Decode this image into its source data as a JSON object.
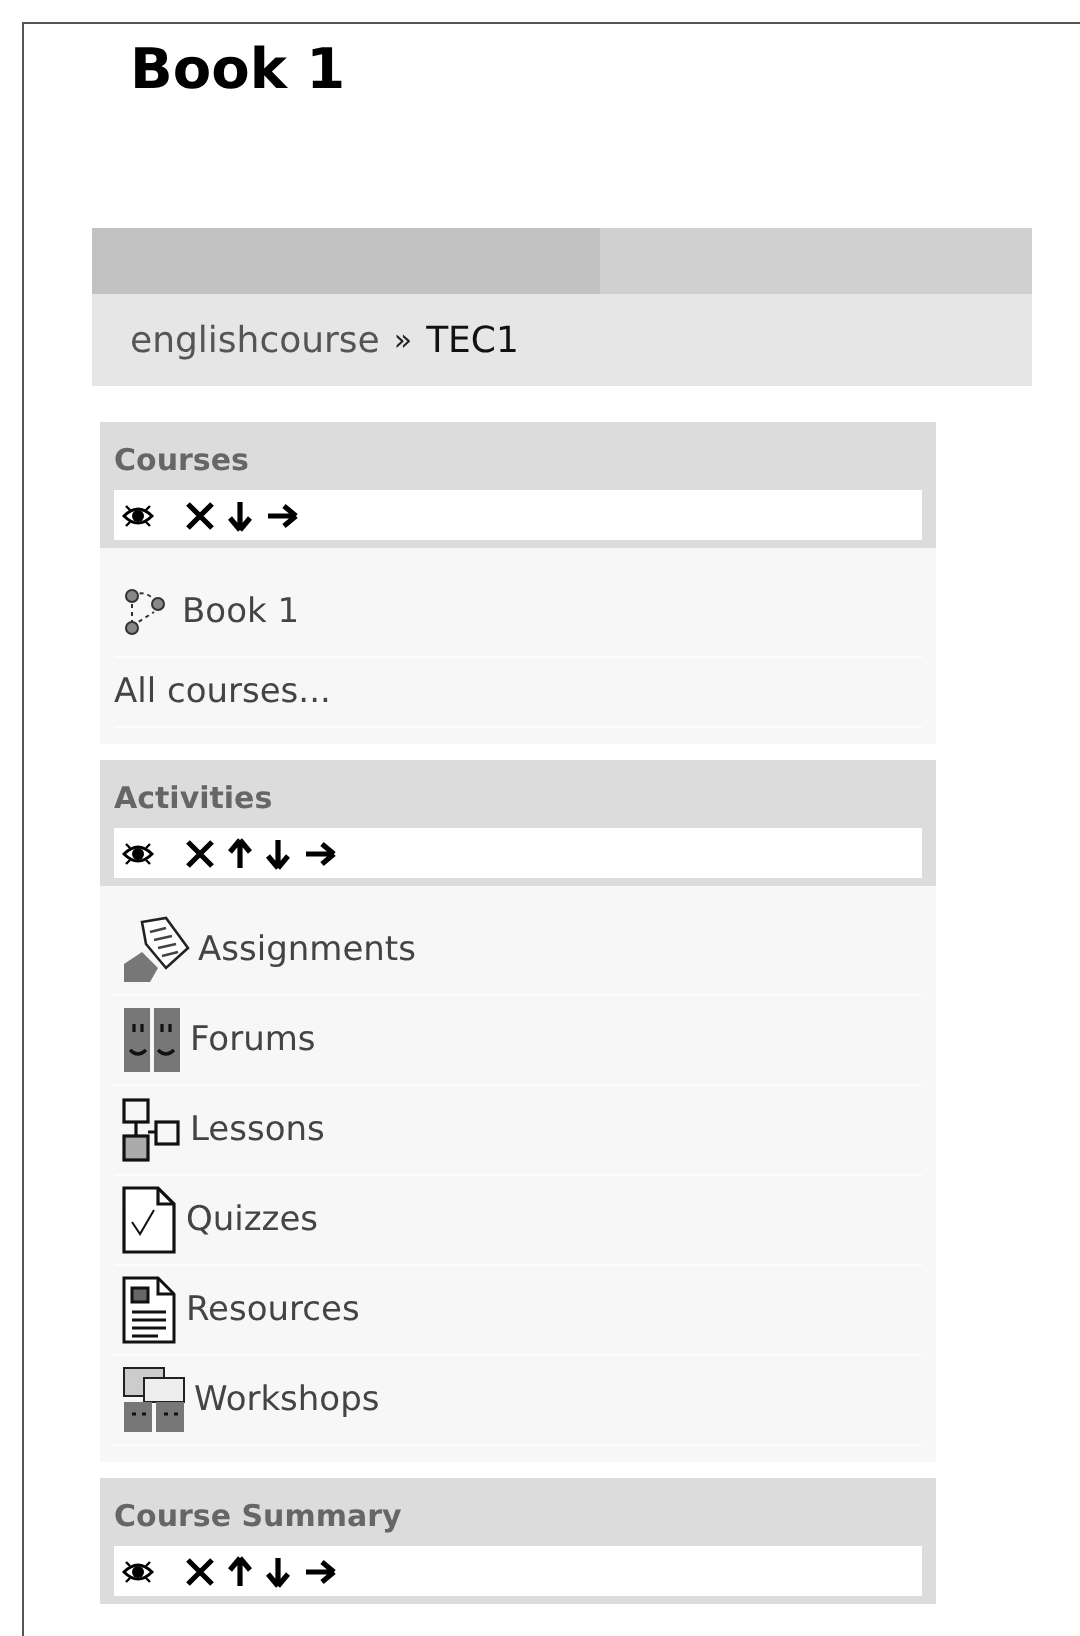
{
  "title": "Book 1",
  "breadcrumb": {
    "parent": "englishcourse",
    "separator": "»",
    "current": "TEC1"
  },
  "blocks": [
    {
      "title": "Courses",
      "controls": [
        {
          "kind": "hide"
        },
        {
          "kind": "delete"
        },
        {
          "kind": "down"
        },
        {
          "kind": "right"
        }
      ],
      "items": [
        {
          "label": "Book 1",
          "kind": "course"
        },
        {
          "label": "All courses...",
          "kind": "plain"
        }
      ]
    },
    {
      "title": "Activities",
      "controls": [
        {
          "kind": "hide"
        },
        {
          "kind": "delete"
        },
        {
          "kind": "up"
        },
        {
          "kind": "down"
        },
        {
          "kind": "right"
        }
      ],
      "items": [
        {
          "label": "Assignments",
          "kind": "assignment"
        },
        {
          "label": "Forums",
          "kind": "forum"
        },
        {
          "label": "Lessons",
          "kind": "lesson"
        },
        {
          "label": "Quizzes",
          "kind": "quiz"
        },
        {
          "label": "Resources",
          "kind": "resource"
        },
        {
          "label": "Workshops",
          "kind": "workshop"
        }
      ]
    },
    {
      "title": "Course Summary",
      "controls": [
        {
          "kind": "hide"
        },
        {
          "kind": "delete"
        },
        {
          "kind": "up"
        },
        {
          "kind": "down"
        },
        {
          "kind": "right"
        }
      ]
    }
  ]
}
